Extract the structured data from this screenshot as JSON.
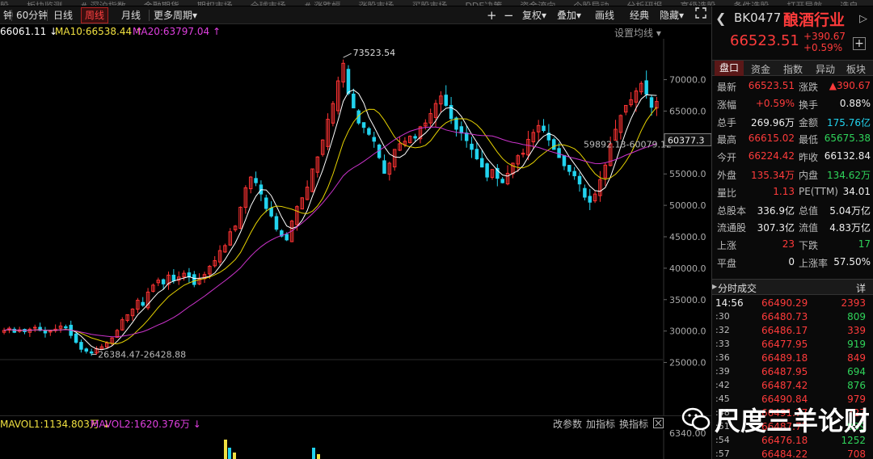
{
  "top_menu": [
    "股",
    "板块监测",
    "# 深沪指数",
    "金融期货",
    "期权市场",
    "全球市场",
    "# 涨跌幅",
    "涨股市场",
    "买股市场",
    "DDE决策",
    "资金流向",
    "个股异动",
    "分析研报",
    "高级选股",
    "条件选股",
    "打开导航",
    "选自"
  ],
  "toolbar": {
    "periods": [
      "钟",
      "60分钟",
      "日线",
      "周线",
      "月线",
      "更多周期"
    ],
    "active_period": "周线",
    "right_buttons": [
      "+",
      "−",
      "复权",
      "叠加",
      "画线",
      "经典",
      "隐藏"
    ],
    "more_periods_arrow": "▾"
  },
  "ma_legend": {
    "ma5": "66061.11",
    "ma10_label": "MA10:",
    "ma10": "66538.44",
    "ma20_label": "MA20:",
    "ma20": "63797.04",
    "ma5_arrow": "↓",
    "ma10_arrow": "↑",
    "ma20_arrow": "↑",
    "settings": "设置均线"
  },
  "chart_data": {
    "type": "candlestick",
    "y_ticks": [
      70000,
      65000,
      60000,
      55000,
      50000,
      45000,
      40000,
      35000,
      30000,
      25000
    ],
    "y_tick_labels": [
      "70000.0",
      "65000.0",
      "60000.0",
      "55000.0",
      "50000.0",
      "45000.0",
      "40000.0",
      "35000.0",
      "30000.0",
      "25000.0"
    ],
    "ylim": [
      22500,
      76500
    ],
    "current_price_tag": "60377.3",
    "annotations": {
      "high": "73523.54",
      "low_range": "26384.47-26428.88",
      "right_range": "59892.13-60079.12"
    },
    "colors": {
      "up": "#ff3333",
      "down": "#22d3ee",
      "ma5": "#ffffff",
      "ma10": "#e6d200",
      "ma20": "#cc33cc"
    },
    "closes": [
      30100,
      30450,
      29800,
      30200,
      29900,
      30300,
      30600,
      30100,
      29700,
      30000,
      30300,
      30800,
      30500,
      29300,
      28200,
      27100,
      26800,
      26500,
      27200,
      27500,
      28100,
      28900,
      30100,
      31800,
      32600,
      33500,
      34900,
      34100,
      36200,
      37300,
      38100,
      37500,
      38900,
      38000,
      38600,
      39200,
      38600,
      37400,
      38300,
      39000,
      40300,
      41200,
      42800,
      43600,
      45800,
      46700,
      49700,
      52800,
      54500,
      53600,
      51800,
      49500,
      48300,
      46200,
      45100,
      44500,
      47500,
      49800,
      51200,
      52900,
      55800,
      57700,
      60400,
      63700,
      66200,
      69800,
      72600,
      67800,
      65500,
      63100,
      62400,
      61300,
      60200,
      57600,
      55100,
      56700,
      58900,
      59800,
      60200,
      61000,
      60700,
      62500,
      63100,
      64600,
      66200,
      67400,
      65900,
      63800,
      62100,
      61500,
      60300,
      58900,
      57400,
      56100,
      54500,
      55700,
      54300,
      53600,
      55100,
      56700,
      57900,
      58300,
      60500,
      61600,
      62700,
      61900,
      60400,
      58900,
      57600,
      56300,
      55400,
      54700,
      53400,
      51300,
      50500,
      51800,
      54100,
      56400,
      59800,
      62100,
      64300,
      65900,
      66800,
      68200,
      69400,
      67700,
      65600,
      66523.51
    ]
  },
  "volume": {
    "mavol1_label": "MAVOL1:",
    "mavol1": "1134.803万",
    "mavol2_label": "MAVOL2:",
    "mavol2": "1620.376万",
    "arrow1": "↓",
    "arrow2": "↓",
    "buttons": [
      "改参数",
      "加指标",
      "换指标"
    ],
    "y_label": "6340.00"
  },
  "right_panel": {
    "code": "BK0477",
    "name": "酿酒行业",
    "price": "66523.51",
    "change": "+390.67",
    "change_pct": "+0.59%",
    "tabs": [
      "盘口",
      "资金",
      "指数",
      "异动",
      "板块"
    ],
    "active_tab": "盘口",
    "stats": [
      [
        "最新",
        "66523.51",
        "涨跌",
        "▲390.67"
      ],
      [
        "涨幅",
        "+0.59%",
        "换手",
        "0.88%"
      ],
      [
        "总手",
        "269.96万",
        "金额",
        "175.76亿"
      ],
      [
        "最高",
        "66615.02",
        "最低",
        "65675.38"
      ],
      [
        "今开",
        "66224.42",
        "昨收",
        "66132.84"
      ],
      [
        "外盘",
        "135.34万",
        "内盘",
        "134.62万"
      ],
      [
        "量比",
        "1.13",
        "PE(TTM)",
        "34.01"
      ],
      [
        "总股本",
        "336.9亿",
        "总值",
        "5.04万亿"
      ],
      [
        "流通股",
        "307.3亿",
        "流值",
        "4.83万亿"
      ],
      [
        "上涨",
        "23",
        "下跌",
        "17"
      ],
      [
        "平盘",
        "0",
        "上涨率",
        "57.50%"
      ]
    ],
    "trade_header": "分时成交",
    "trade_detail": "详",
    "trades": [
      [
        "14:56",
        "66490.29",
        "2393"
      ],
      [
        ":30",
        "66480.73",
        "809"
      ],
      [
        ":32",
        "66486.17",
        "339"
      ],
      [
        ":33",
        "66477.95",
        "919"
      ],
      [
        ":36",
        "66489.18",
        "849"
      ],
      [
        ":39",
        "66487.95",
        "694"
      ],
      [
        ":42",
        "66487.42",
        "876"
      ],
      [
        ":45",
        "66490.84",
        "979"
      ],
      [
        ":48",
        "66491.77",
        "727"
      ],
      [
        ":51",
        "66487.77",
        "939"
      ],
      [
        ":54",
        "66476.18",
        "1252"
      ],
      [
        ":57",
        "66484.22",
        "708"
      ]
    ]
  },
  "watermark": "尺度三羊论财"
}
